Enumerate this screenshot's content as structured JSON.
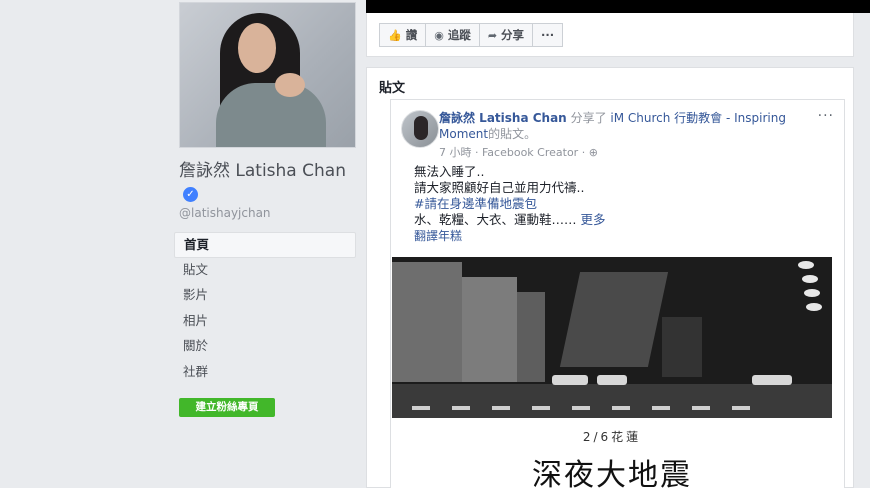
{
  "profile": {
    "name": "詹詠然 Latisha Chan",
    "verified_icon": "check",
    "handle": "@latishayjchan"
  },
  "nav": {
    "items": [
      {
        "label": "首頁",
        "active": true
      },
      {
        "label": "貼文"
      },
      {
        "label": "影片"
      },
      {
        "label": "相片"
      },
      {
        "label": "關於"
      },
      {
        "label": "社群"
      }
    ],
    "create_button": "建立粉絲專頁"
  },
  "actions": {
    "like": "讚",
    "follow": "追蹤",
    "share": "分享",
    "more": "···"
  },
  "posts_section": {
    "title": "貼文"
  },
  "post": {
    "author": "詹詠然 Latisha Chan",
    "shared_text": "分享了",
    "shared_page": "iM Church 行動教會 - Inspiring Moment",
    "post_suffix": "的貼文。",
    "meta": "7 小時 · Facebook Creator · ⊕",
    "more_icon": "···",
    "line1": "無法入睡了..",
    "line2": "請大家照顧好自己並用力代禱..",
    "hashtag": "#請在身邊準備地震包",
    "line3": "水、乾糧、大衣、運動鞋……",
    "see_more": "更多",
    "translate": "翻譯年糕",
    "image_date": "2/6花蓮",
    "image_title": "深夜大地震"
  },
  "colors": {
    "link": "#365899",
    "green_button": "#42b72a",
    "background": "#e9ebee"
  }
}
